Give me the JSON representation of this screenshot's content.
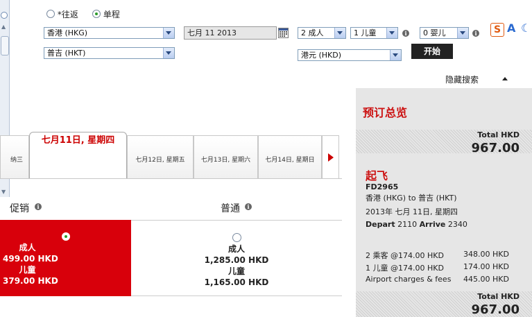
{
  "trip_type": {
    "round_trip": "*往返",
    "one_way": "单程",
    "selected": "one_way"
  },
  "origin": "香港 (HKG)",
  "destination": "普吉 (HKT)",
  "date": "七月 11 2013",
  "adults": "2 成人",
  "children": "1 儿童",
  "infants": "0 婴儿",
  "currency": "港元 (HKD)",
  "start_label": "开始",
  "hide_search_label": "隐藏搜索",
  "tabs": {
    "prev_partial": "纳三",
    "active": "七月11日, 星期四",
    "items": [
      "七月12日, 星期五",
      "七月13日, 星期六",
      "七月14日, 星期日"
    ]
  },
  "fare_headers": {
    "promo": "促销",
    "regular": "普通"
  },
  "promo_fare": {
    "adult_label": "成人",
    "adult_price": "499.00 HKD",
    "child_label": "儿童",
    "child_price": "379.00 HKD"
  },
  "regular_fare": {
    "adult_label": "成人",
    "adult_price": "1,285.00 HKD",
    "child_label": "儿童",
    "child_price": "1,165.00 HKD"
  },
  "summary": {
    "title": "预订总览",
    "total_label": "Total HKD",
    "total_value": "967.00",
    "depart_title": "起飞",
    "flight_no": "FD2965",
    "route": "香港 (HKG) to 普吉 (HKT)",
    "date": "2013年 七月 11日, 星期四",
    "depart_label": "Depart",
    "depart_time": "2110",
    "arrive_label": "Arrive",
    "arrive_time": "2340",
    "lines": [
      {
        "desc": "2 乘客 @174.00 HKD",
        "amount": "348.00 HKD"
      },
      {
        "desc": "1 儿童 @174.00 HKD",
        "amount": "174.00 HKD"
      },
      {
        "desc": "Airport charges & fees",
        "amount": "445.00 HKD"
      }
    ],
    "bottom_total_label": "Total HKD",
    "bottom_total_value": "967.00"
  },
  "colors": {
    "brand_red": "#d8000b",
    "panel_bg": "#e6e6e6"
  },
  "icons": [
    "calendar-icon",
    "info-icon",
    "sogou-ime-icon",
    "collapse-triangle-icon",
    "next-arrow-icon"
  ]
}
